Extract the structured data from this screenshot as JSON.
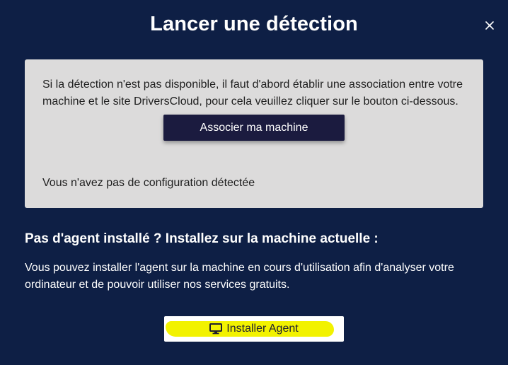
{
  "dialog": {
    "title": "Lancer une détection",
    "close_icon": "close-icon"
  },
  "panel": {
    "info_text": "Si la détection n'est pas disponible, il faut d'abord établir une association entre votre machine et le site DriversCloud, pour cela veuillez cliquer sur le bouton ci-dessous.",
    "associate_button_label": "Associer ma machine",
    "no_config_text": "Vous n'avez pas de configuration détectée"
  },
  "agent": {
    "heading": "Pas d'agent installé ? Installez sur la machine actuelle :",
    "description": "Vous pouvez installer l'agent sur la machine en cours d'utilisation afin d'analyser votre ordinateur et de pouvoir utiliser nos services gratuits.",
    "install_button_label": "Installer Agent",
    "install_button_icon": "monitor-icon"
  },
  "colors": {
    "background": "#0e1f45",
    "panel": "#dcdbdb",
    "associate_button": "#1b1b3f",
    "highlight": "#f2f200"
  }
}
